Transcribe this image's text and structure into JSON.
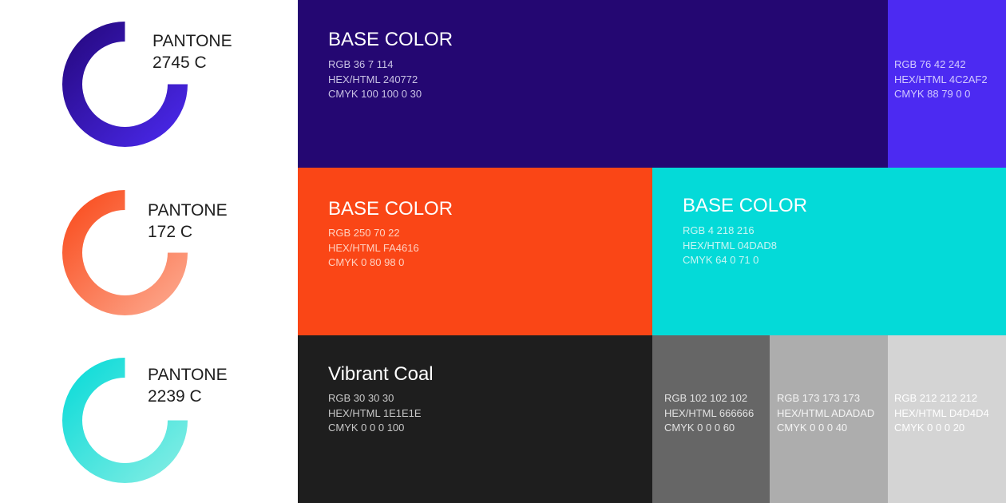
{
  "pantones": [
    {
      "line1": "PANTONE",
      "line2": "2745 C",
      "gradient_start": "#24077a",
      "gradient_end": "#4c2af2"
    },
    {
      "line1": "PANTONE",
      "line2": "172 C",
      "gradient_start": "#fa4616",
      "gradient_end": "#fcae95"
    },
    {
      "line1": "PANTONE",
      "line2": "2239 C",
      "gradient_start": "#04dad8",
      "gradient_end": "#8aeee4"
    }
  ],
  "blocks": [
    {
      "id": "navy-base",
      "title": "BASE COLOR",
      "rgb": "RGB 36 7 114",
      "hex": "HEX/HTML 240772",
      "cmyk": "CMYK 100 100 0 30",
      "color": "#240772",
      "text_color": "#ffffff",
      "spec_color": "#c9c2e4"
    },
    {
      "id": "violet",
      "title": "",
      "rgb": "RGB 76 42 242",
      "hex": "HEX/HTML 4C2AF2",
      "cmyk": "CMYK 88 79 0 0",
      "color": "#4c2af2",
      "text_color": "#ffffff",
      "spec_color": "#d2caff"
    },
    {
      "id": "orange-base",
      "title": "BASE COLOR",
      "rgb": "RGB 250 70 22",
      "hex": "HEX/HTML FA4616",
      "cmyk": "CMYK 0 80 98 0",
      "color": "#fa4616",
      "text_color": "#ffffff",
      "spec_color": "#ffd0c0"
    },
    {
      "id": "teal-base",
      "title": "BASE COLOR",
      "rgb": "RGB 4 218 216",
      "hex": "HEX/HTML 04DAD8",
      "cmyk": "CMYK 64 0 71 0",
      "color": "#04dad8",
      "text_color": "#ffffff",
      "spec_color": "#c8f6f4"
    },
    {
      "id": "coal-base",
      "title": "Vibrant Coal",
      "rgb": "RGB 30 30 30",
      "hex": "HEX/HTML 1E1E1E",
      "cmyk": "CMYK 0 0 0 100",
      "color": "#1e1e1e",
      "text_color": "#ffffff",
      "spec_color": "#c8c8c8"
    },
    {
      "id": "gray-666",
      "title": "",
      "rgb": "RGB 102 102 102",
      "hex": "HEX/HTML 666666",
      "cmyk": "CMYK 0 0 0 60",
      "color": "#666666",
      "text_color": "#ffffff",
      "spec_color": "#e2e2e2"
    },
    {
      "id": "gray-adadad",
      "title": "",
      "rgb": "RGB 173 173 173",
      "hex": "HEX/HTML ADADAD",
      "cmyk": "CMYK 0 0 0 40",
      "color": "#adadad",
      "text_color": "#ffffff",
      "spec_color": "#f4f4f4"
    },
    {
      "id": "gray-d4d4d4",
      "title": "",
      "rgb": "RGB 212 212 212",
      "hex": "HEX/HTML D4D4D4",
      "cmyk": "CMYK 0 0 0 20",
      "color": "#d4d4d4",
      "text_color": "#ffffff",
      "spec_color": "#ffffff"
    }
  ]
}
